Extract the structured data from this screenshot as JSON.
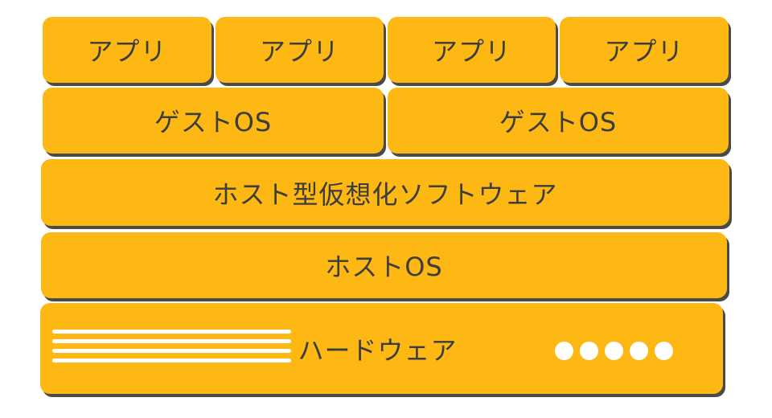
{
  "diagram": {
    "apps": [
      "アプリ",
      "アプリ",
      "アプリ",
      "アプリ"
    ],
    "guest_os": [
      "ゲストOS",
      "ゲストOS"
    ],
    "host_virtualization": "ホスト型仮想化ソフトウェア",
    "host_os": "ホストOS",
    "hardware": "ハードウェア"
  },
  "colors": {
    "block_fill": "#FDB813",
    "block_shadow": "#4a4a4a",
    "text": "#3d3d3d",
    "ornament": "#ffffff"
  }
}
